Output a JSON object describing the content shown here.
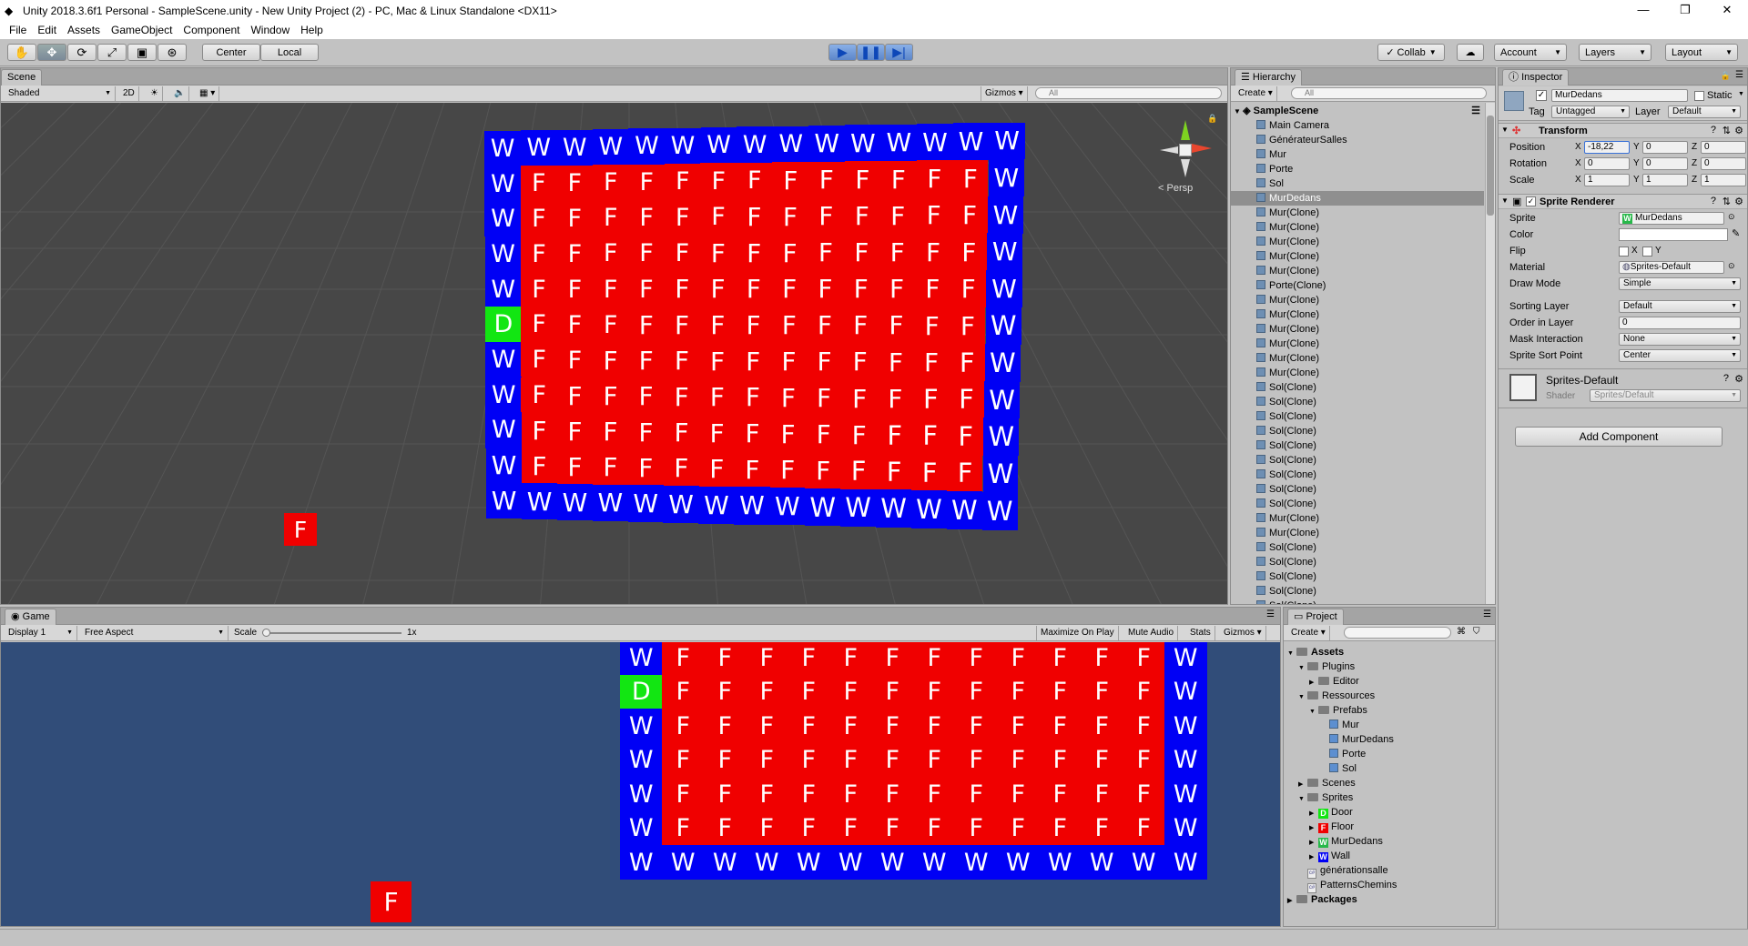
{
  "window": {
    "title": "Unity 2018.3.6f1 Personal - SampleScene.unity - New Unity Project (2) - PC, Mac & Linux Standalone <DX11>"
  },
  "menu": [
    "File",
    "Edit",
    "Assets",
    "GameObject",
    "Component",
    "Window",
    "Help"
  ],
  "toolbar": {
    "tools": [
      "hand-icon",
      "move-icon",
      "rotate-icon",
      "scale-icon",
      "rect-icon",
      "transform-icon"
    ],
    "tool_glyphs": [
      "✋",
      "✥",
      "⟳",
      "⤢",
      "▣",
      "⊛"
    ],
    "center": "Center",
    "local": "Local",
    "collab": "Collab",
    "account": "Account",
    "layers": "Layers",
    "layout": "Layout"
  },
  "scene": {
    "tab": "Scene",
    "shaded": "Shaded",
    "mode2d": "2D",
    "gizmos": "Gizmos",
    "search_placeholder": "All",
    "persp": "Persp"
  },
  "grid": {
    "rows": [
      "WWWWWWWWWWWWWWW",
      "WFFFFFFFFFFFFFW",
      "WFFFFFFFFFFFFFW",
      "WFFFFFFFFFFFFFW",
      "WFFFFFFFFFFFFFW",
      "DFFFFFFFFFFFFFW",
      "WFFFFFFFFFFFFFW",
      "WFFFFFFFFFFFFFW",
      "WFFFFFFFFFFFFFW",
      "WFFFFFFFFFFFFFW",
      "WWWWWWWWWWWWWWW"
    ],
    "stray": "F"
  },
  "game": {
    "tab": "Game",
    "display": "Display 1",
    "aspect": "Free Aspect",
    "scale_label": "Scale",
    "scale_value": "1x",
    "maximize": "Maximize On Play",
    "mute": "Mute Audio",
    "stats": "Stats",
    "gizmos": "Gizmos",
    "rows": [
      "WFFFFFFFFFFFFW",
      "DFFFFFFFFFFFFW",
      "WFFFFFFFFFFFFW",
      "WFFFFFFFFFFFFW",
      "WFFFFFFFFFFFFW",
      "WFFFFFFFFFFFFW",
      "WWWWWWWWWWWWWW"
    ],
    "stray": "F"
  },
  "hierarchy": {
    "tab": "Hierarchy",
    "create": "Create",
    "search_placeholder": "All",
    "scene": "SampleScene",
    "items": [
      "Main Camera",
      "GénérateurSalles",
      "Mur",
      "Porte",
      "Sol",
      "MurDedans",
      "Mur(Clone)",
      "Mur(Clone)",
      "Mur(Clone)",
      "Mur(Clone)",
      "Mur(Clone)",
      "Porte(Clone)",
      "Mur(Clone)",
      "Mur(Clone)",
      "Mur(Clone)",
      "Mur(Clone)",
      "Mur(Clone)",
      "Mur(Clone)",
      "Sol(Clone)",
      "Sol(Clone)",
      "Sol(Clone)",
      "Sol(Clone)",
      "Sol(Clone)",
      "Sol(Clone)",
      "Sol(Clone)",
      "Sol(Clone)",
      "Sol(Clone)",
      "Mur(Clone)",
      "Mur(Clone)",
      "Sol(Clone)",
      "Sol(Clone)",
      "Sol(Clone)",
      "Sol(Clone)",
      "Sol(Clone)"
    ],
    "selected": 5
  },
  "inspector": {
    "tab": "Inspector",
    "name": "MurDedans",
    "static": "Static",
    "tag_label": "Tag",
    "tag": "Untagged",
    "layer_label": "Layer",
    "layer": "Default",
    "transform": {
      "title": "Transform",
      "position": "Position",
      "rotation": "Rotation",
      "scale": "Scale",
      "pos": [
        "-18,22",
        "0",
        "0"
      ],
      "rot": [
        "0",
        "0",
        "0"
      ],
      "scl": [
        "1",
        "1",
        "1"
      ],
      "axes": [
        "X",
        "Y",
        "Z"
      ]
    },
    "sprite_renderer": {
      "title": "Sprite Renderer",
      "labels": [
        "Sprite",
        "Color",
        "Flip",
        "Material",
        "Draw Mode",
        "Sorting Layer",
        "Order in Layer",
        "Mask Interaction",
        "Sprite Sort Point"
      ],
      "sprite": "MurDedans",
      "flip_x": "X",
      "flip_y": "Y",
      "material": "Sprites-Default",
      "draw_mode": "Simple",
      "sorting_layer": "Default",
      "order": "0",
      "mask": "None",
      "sort_point": "Center"
    },
    "material": {
      "name": "Sprites-Default",
      "shader_label": "Shader",
      "shader": "Sprites/Default"
    },
    "add_component": "Add Component"
  },
  "project": {
    "tab": "Project",
    "create": "Create",
    "tree": [
      {
        "t": "Assets",
        "lvl": 0,
        "k": "folder",
        "bold": true,
        "arrow": "▼"
      },
      {
        "t": "Plugins",
        "lvl": 1,
        "k": "folder",
        "arrow": "▼"
      },
      {
        "t": "Editor",
        "lvl": 2,
        "k": "folder",
        "arrow": "▶"
      },
      {
        "t": "Ressources",
        "lvl": 1,
        "k": "folder",
        "arrow": "▼"
      },
      {
        "t": "Prefabs",
        "lvl": 2,
        "k": "folder",
        "arrow": "▼"
      },
      {
        "t": "Mur",
        "lvl": 3,
        "k": "prefab"
      },
      {
        "t": "MurDedans",
        "lvl": 3,
        "k": "prefab"
      },
      {
        "t": "Porte",
        "lvl": 3,
        "k": "prefab"
      },
      {
        "t": "Sol",
        "lvl": 3,
        "k": "prefab"
      },
      {
        "t": "Scenes",
        "lvl": 1,
        "k": "folder",
        "arrow": "▶"
      },
      {
        "t": "Sprites",
        "lvl": 1,
        "k": "folder",
        "arrow": "▼"
      },
      {
        "t": "Door",
        "lvl": 2,
        "k": "sprite",
        "c": "#12e612",
        "g": "D",
        "arrow": "▶"
      },
      {
        "t": "Floor",
        "lvl": 2,
        "k": "sprite",
        "c": "#f00000",
        "g": "F",
        "arrow": "▶"
      },
      {
        "t": "MurDedans",
        "lvl": 2,
        "k": "sprite",
        "c": "#27b84a",
        "g": "W",
        "arrow": "▶"
      },
      {
        "t": "Wall",
        "lvl": 2,
        "k": "sprite",
        "c": "#0000f5",
        "g": "W",
        "arrow": "▶"
      },
      {
        "t": "générationsalle",
        "lvl": 1,
        "k": "script"
      },
      {
        "t": "PatternsChemins",
        "lvl": 1,
        "k": "script"
      },
      {
        "t": "Packages",
        "lvl": 0,
        "k": "folder",
        "bold": true,
        "arrow": "▶"
      }
    ]
  },
  "colors": {
    "wall": "#0000f5",
    "floor": "#f00000",
    "door": "#12e612",
    "scene_bg": "#474747",
    "game_bg": "#314d79"
  }
}
